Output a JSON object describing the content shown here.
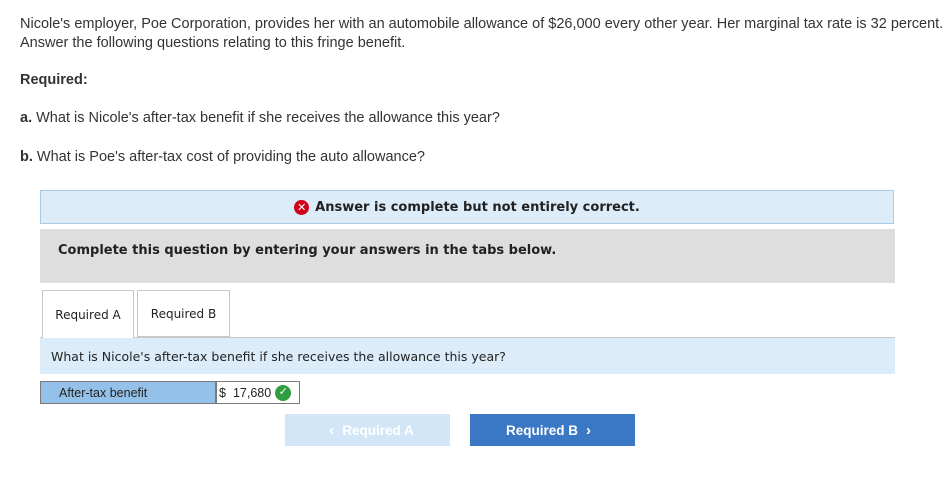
{
  "problem": {
    "intro": "Nicole's employer, Poe Corporation, provides her with an automobile allowance of $26,000 every other year. Her marginal tax rate is 32 percent. Answer the following questions relating to this fringe benefit.",
    "required_heading": "Required:",
    "question_a_letter": "a.",
    "question_a": "What is Nicole's after-tax benefit if she receives the allowance this year?",
    "question_b_letter": "b.",
    "question_b": "What is Poe's after-tax cost of providing the auto allowance?"
  },
  "status": {
    "icon": "x-circle-icon",
    "message": "Answer is complete but not entirely correct.",
    "error_color": "#d0021b"
  },
  "instructions": "Complete this question by entering your answers in the tabs below.",
  "tabs": [
    {
      "label": "Required A"
    },
    {
      "label": "Required B"
    }
  ],
  "active_tab": {
    "question": "What is Nicole's after-tax benefit if she receives the allowance this year?",
    "row_label": "After-tax benefit",
    "currency": "$",
    "value": "17,680",
    "result_icon": "check-circle-icon",
    "correct_color": "#2e9e3e"
  },
  "navigation": {
    "prev_label": "Required A",
    "next_label": "Required B"
  }
}
